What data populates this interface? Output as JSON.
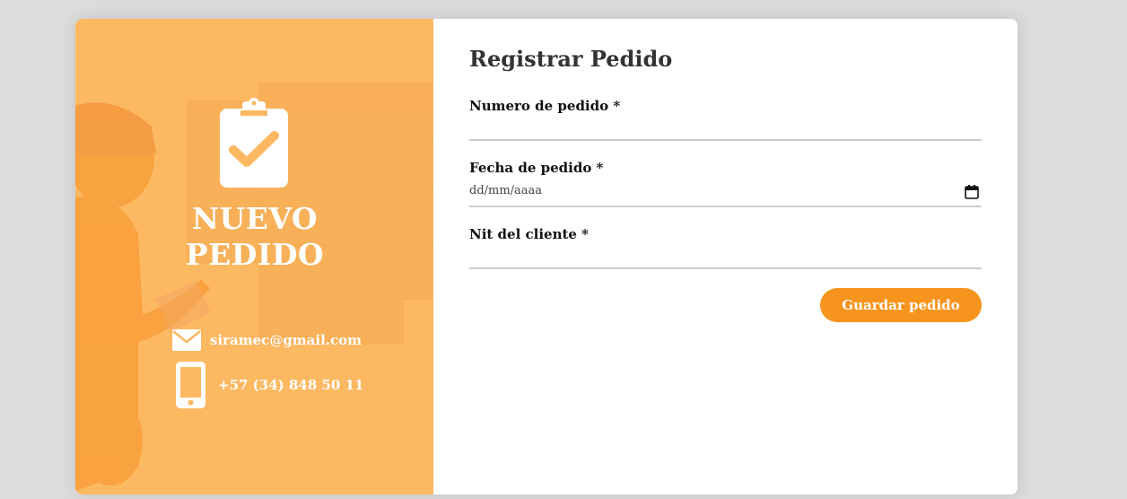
{
  "hero": {
    "title_line1": "NUEVO",
    "title_line2": "PEDIDO",
    "email": "siramec@gmail.com",
    "phone": "+57 (34) 848 50 11"
  },
  "form": {
    "title": "Registrar Pedido",
    "order_number_label": "Numero de pedido *",
    "order_number_value": "",
    "order_date_label": "Fecha de pedido *",
    "order_date_placeholder": "dd/mm/aaaa",
    "client_nit_label": "Nit del cliente *",
    "client_nit_value": "",
    "save_button": "Guardar pedido"
  },
  "colors": {
    "accent": "#f7941e",
    "hero_bg": "#fdb862"
  }
}
